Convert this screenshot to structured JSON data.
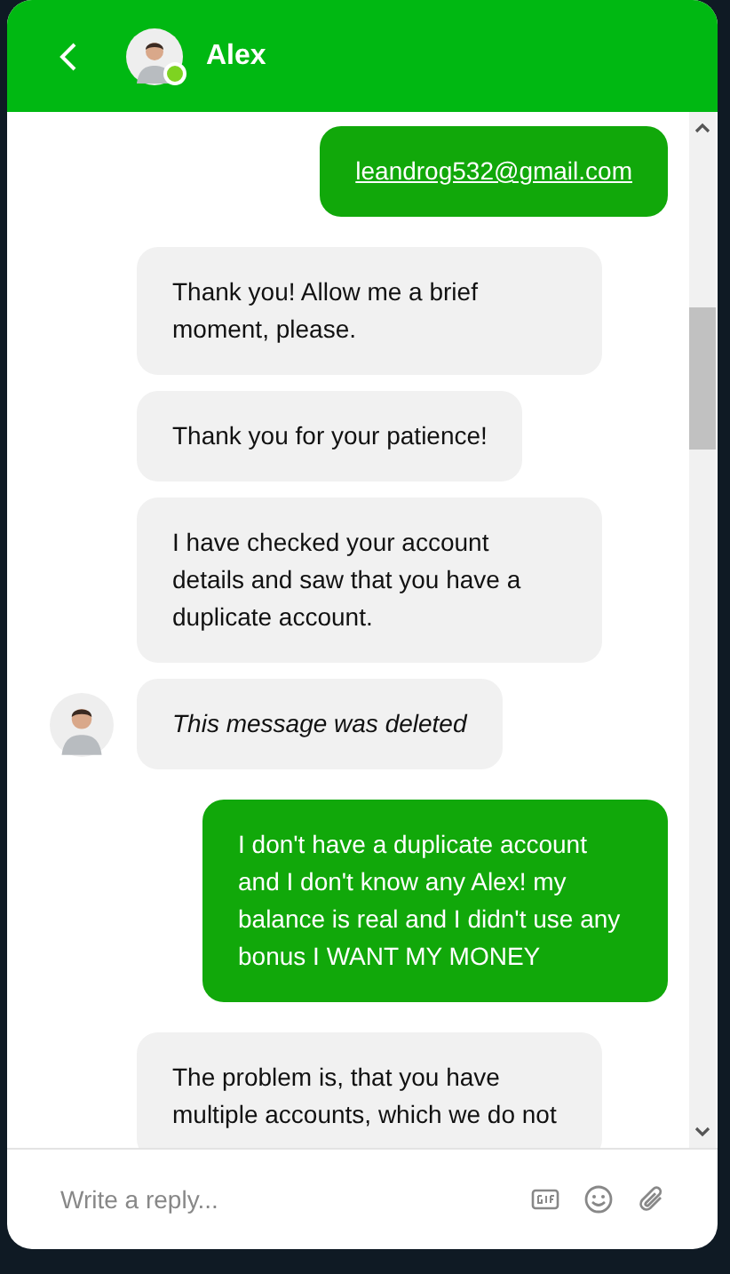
{
  "header": {
    "title": "Alex",
    "online": true
  },
  "messages": [
    {
      "kind": "user",
      "text": "leandrog532@gmail.com",
      "link": true,
      "deleted": false
    },
    {
      "kind": "agent",
      "text": "Thank you! Allow me a brief moment, please.",
      "link": false,
      "deleted": false
    },
    {
      "kind": "agent",
      "text": "Thank you for your patience!",
      "link": false,
      "deleted": false
    },
    {
      "kind": "agent",
      "text": "I have checked your account details and saw that you have a duplicate account.",
      "link": false,
      "deleted": false
    },
    {
      "kind": "agent",
      "text": "This message was deleted",
      "link": false,
      "deleted": true
    },
    {
      "kind": "user",
      "text": "I don't have a duplicate account and I don't know any Alex! my balance is real and I didn't use any bonus I WANT MY MONEY",
      "link": false,
      "deleted": false
    },
    {
      "kind": "agent",
      "text": "The problem is, that you have multiple accounts, which we do not",
      "link": false,
      "deleted": false
    }
  ],
  "composer": {
    "placeholder": "Write a reply..."
  }
}
